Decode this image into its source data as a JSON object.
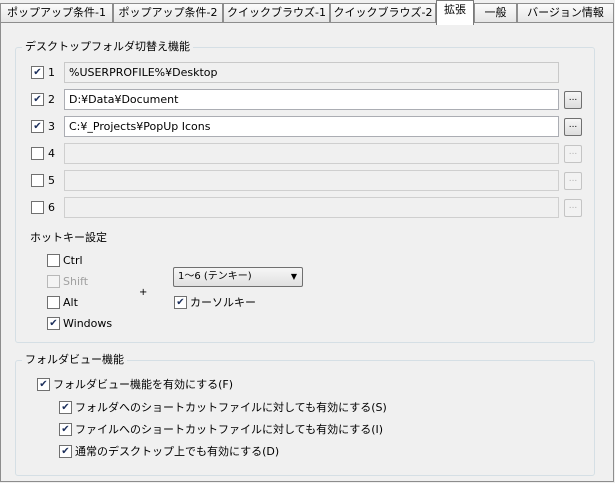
{
  "tabs": [
    "ポップアップ条件-1",
    "ポップアップ条件-2",
    "クイックブラウズ-1",
    "クイックブラウズ-2",
    "拡張",
    "一般",
    "バージョン情報"
  ],
  "desktop_switch": {
    "title": "デスクトップフォルダ切替え機能",
    "rows": [
      {
        "num": "1",
        "checked": true,
        "path": "%USERPROFILE%¥Desktop"
      },
      {
        "num": "2",
        "checked": true,
        "path": "D:¥Data¥Document"
      },
      {
        "num": "3",
        "checked": true,
        "path": "C:¥_Projects¥PopUp Icons"
      },
      {
        "num": "4",
        "checked": false,
        "path": ""
      },
      {
        "num": "5",
        "checked": false,
        "path": ""
      },
      {
        "num": "6",
        "checked": false,
        "path": ""
      }
    ],
    "browse_label": "...",
    "hotkey": {
      "title": "ホットキー設定",
      "ctrl": "Ctrl",
      "shift": "Shift",
      "alt": "Alt",
      "windows": "Windows",
      "plus": "+",
      "key_select": "1～6 (テンキー)",
      "cursor_key": "カーソルキー"
    }
  },
  "folder_view": {
    "title": "フォルダビュー機能",
    "enable": "フォルダビュー機能を有効にする(F)",
    "folder_shortcut": "フォルダへのショートカットファイルに対しても有効にする(S)",
    "file_shortcut": "ファイルへのショートカットファイルに対しても有効にする(I)",
    "desktop": "通常のデスクトップ上でも有効にする(D)"
  }
}
